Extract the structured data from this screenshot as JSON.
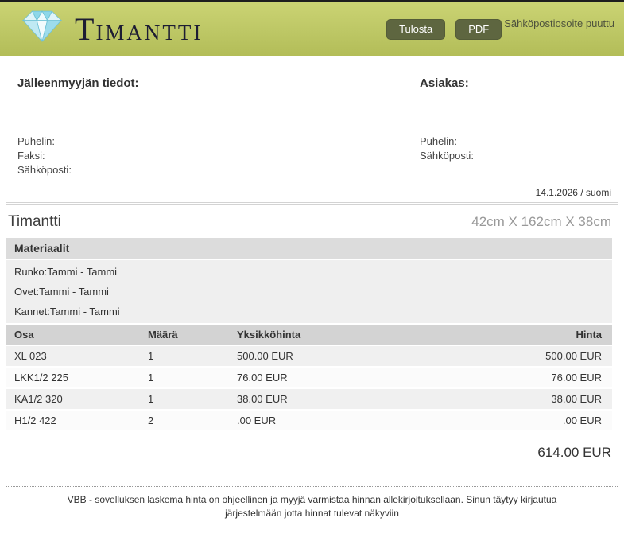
{
  "header": {
    "brand_initial": "T",
    "brand_rest": "IMANTTI",
    "print_button": "Tulosta",
    "pdf_button": "PDF",
    "notice": "Sähköpostiosoite puuttu"
  },
  "parties": {
    "dealer": {
      "title": "Jälleenmyyjän tiedot:",
      "labels": [
        "Puhelin:",
        "Faksi:",
        "Sähköposti:"
      ]
    },
    "customer": {
      "title": "Asiakas:",
      "labels": [
        "Puhelin:",
        "Sähköposti:"
      ]
    }
  },
  "meta": {
    "date_locale": "14.1.2026 / suomi"
  },
  "product": {
    "name": "Timantti",
    "dimensions": "42cm X 162cm X 38cm"
  },
  "materials": {
    "header": "Materiaalit",
    "rows": [
      "Runko:Tammi - Tammi",
      "Ovet:Tammi - Tammi",
      "Kannet:Tammi - Tammi"
    ]
  },
  "parts_table": {
    "columns": [
      "Osa",
      "Määrä",
      "Yksikköhinta",
      "Hinta"
    ],
    "rows": [
      {
        "osa": "XL 023",
        "maara": "1",
        "yksikkohinta": "500.00 EUR",
        "hinta": "500.00 EUR"
      },
      {
        "osa": "LKK1/2 225",
        "maara": "1",
        "yksikkohinta": "76.00 EUR",
        "hinta": "76.00 EUR"
      },
      {
        "osa": "KA1/2 320",
        "maara": "1",
        "yksikkohinta": "38.00 EUR",
        "hinta": "38.00 EUR"
      },
      {
        "osa": "H1/2 422",
        "maara": "2",
        "yksikkohinta": ".00 EUR",
        "hinta": ".00 EUR"
      }
    ],
    "total": "614.00 EUR"
  },
  "footer": {
    "disclaimer": "VBB - sovelluksen laskema hinta on ohjeellinen ja myyjä varmistaa hinnan allekirjoituksellaan. Sinun täytyy kirjautua järjestelmään jotta hinnat tulevat näkyviin"
  },
  "colors": {
    "header_bg": "#bdc765",
    "button_bg": "#5e6640",
    "table_header_bg": "#d3d3d3",
    "row_alt_bg": "#f0f0f0"
  }
}
